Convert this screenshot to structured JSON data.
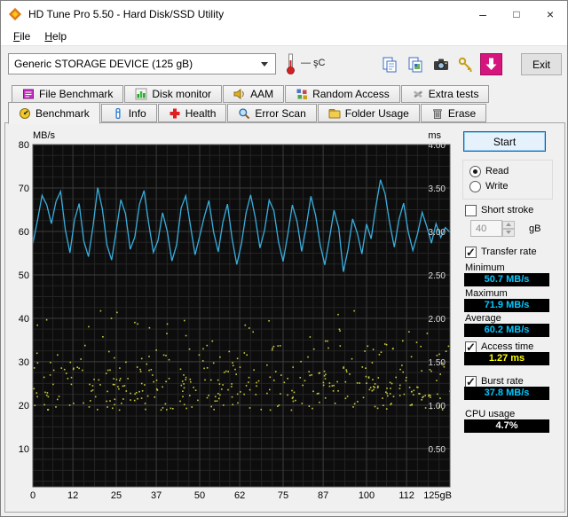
{
  "window": {
    "title": "HD Tune Pro 5.50 - Hard Disk/SSD Utility",
    "controls": {
      "minimize": "–",
      "maximize": "□",
      "close": "×"
    }
  },
  "menu": {
    "file": {
      "accel": "F",
      "rest": "ile"
    },
    "help": {
      "accel": "H",
      "rest": "elp"
    }
  },
  "toolbar": {
    "device": "Generic STORAGE DEVICE (125 gB)",
    "temperature": "—  şC",
    "exit_label": "Exit",
    "icon_names": [
      "thermometer-icon",
      "copy-text-icon",
      "copy-image-icon",
      "camera-icon",
      "serial-key-icon",
      "save-image-button",
      "chevron-down-icon"
    ]
  },
  "tabs": {
    "row1": [
      {
        "label": "File Benchmark",
        "icon": "file-benchmark-icon"
      },
      {
        "label": "Disk monitor",
        "icon": "disk-monitor-icon"
      },
      {
        "label": "AAM",
        "icon": "aam-icon"
      },
      {
        "label": "Random Access",
        "icon": "random-access-icon"
      },
      {
        "label": "Extra tests",
        "icon": "extra-tests-icon"
      }
    ],
    "row2": [
      {
        "label": "Benchmark",
        "icon": "benchmark-icon",
        "active": true
      },
      {
        "label": "Info",
        "icon": "info-icon"
      },
      {
        "label": "Health",
        "icon": "health-icon"
      },
      {
        "label": "Error Scan",
        "icon": "error-scan-icon"
      },
      {
        "label": "Folder Usage",
        "icon": "folder-usage-icon"
      },
      {
        "label": "Erase",
        "icon": "erase-icon"
      }
    ]
  },
  "side": {
    "start_label": "Start",
    "read_label": "Read",
    "write_label": "Write",
    "short_stroke_label": "Short stroke",
    "short_stroke_value": "40",
    "short_stroke_unit": "gB",
    "transfer_rate_label": "Transfer rate",
    "minimum_label": "Minimum",
    "minimum_value": "50.7 MB/s",
    "maximum_label": "Maximum",
    "maximum_value": "71.9 MB/s",
    "average_label": "Average",
    "average_value": "60.2 MB/s",
    "access_time_label": "Access time",
    "access_time_value": "1.27 ms",
    "burst_rate_label": "Burst rate",
    "burst_rate_value": "37.8 MB/s",
    "cpu_usage_label": "CPU usage",
    "cpu_usage_value": "4.7%"
  },
  "colors": {
    "plot_bg": "#0d0d0d",
    "grid_major": "#3d3d3d",
    "grid_minor": "#242424",
    "transfer_line": "#38aede",
    "access_dots": "#c9c93d",
    "value_cyan": "#00c8ff",
    "value_yellow": "#ffff00",
    "save_button_magenta": "#d6147e",
    "start_focus_blue": "#0063b1"
  },
  "chart_data": {
    "type": "line",
    "title": "",
    "grid": true,
    "left_axis": {
      "label": "MB/s",
      "max": 80,
      "min": 1.2,
      "ticks": [
        80,
        70,
        60,
        50,
        40,
        30,
        20,
        10
      ]
    },
    "right_axis": {
      "label": "ms",
      "max": 4.0,
      "min": 0.06,
      "ticks": [
        "4.00",
        "3.50",
        "3.00",
        "2.50",
        "2.00",
        "1.50",
        "1.00",
        "0.50"
      ]
    },
    "x_axis": {
      "min": 0,
      "max": 125,
      "tick_values": [
        0,
        12,
        25,
        37,
        50,
        62,
        75,
        87,
        100,
        112,
        125
      ],
      "tick_labels": [
        "0",
        "12",
        "25",
        "37",
        "50",
        "62",
        "75",
        "87",
        "100",
        "112",
        "125gB"
      ]
    },
    "series": [
      {
        "name": "transfer-rate",
        "type": "line",
        "unit": "MB/s",
        "color": "#38aede",
        "x_start": 0,
        "x_end": 125,
        "values": [
          57.2,
          62.5,
          68.3,
          66.1,
          61.8,
          66.9,
          69.2,
          60.4,
          55.1,
          62.7,
          66.4,
          57.8,
          54.2,
          61.3,
          70.1,
          65.2,
          56.8,
          53.4,
          60.2,
          67.3,
          64.1,
          55.9,
          58.7,
          66.2,
          69.4,
          61.8,
          55.2,
          57.9,
          64.3,
          60.1,
          53.2,
          56.8,
          65.4,
          68.2,
          61.3,
          54.6,
          58.9,
          63.4,
          67.1,
          59.8,
          55.3,
          62.1,
          66.3,
          58.2,
          52.4,
          57.1,
          64.2,
          68.4,
          63.1,
          56.2,
          60.3,
          67.2,
          64.8,
          57.6,
          53.1,
          59.2,
          66.1,
          62.3,
          55.4,
          61.2,
          68.1,
          63.7,
          56.9,
          52.3,
          58.4,
          64.9,
          60.8,
          50.7,
          55.8,
          62.9,
          59.6,
          54.8,
          61.7,
          58.3,
          65.6,
          71.9,
          68.7,
          61.9,
          56.4,
          62.8,
          66.5,
          59.9,
          55.6,
          59.4,
          64.4,
          61.1,
          57.3,
          61.8,
          58.6,
          60.9,
          59.8
        ]
      },
      {
        "name": "access-time",
        "type": "scatter",
        "unit": "ms",
        "color": "#c9c93d",
        "seed": 77,
        "count": 400,
        "distribution": {
          "ms_core": [
            0.95,
            1.45
          ],
          "ms_mid": [
            1.45,
            1.75
          ],
          "ms_high": [
            1.75,
            2.1
          ],
          "p_core": 0.78,
          "p_mid": 0.17
        }
      }
    ],
    "stats": {
      "minimum": "50.7 MB/s",
      "maximum": "71.9 MB/s",
      "average": "60.2 MB/s",
      "access_time": "1.27 ms",
      "burst_rate": "37.8 MB/s",
      "cpu_usage": "4.7%"
    }
  }
}
